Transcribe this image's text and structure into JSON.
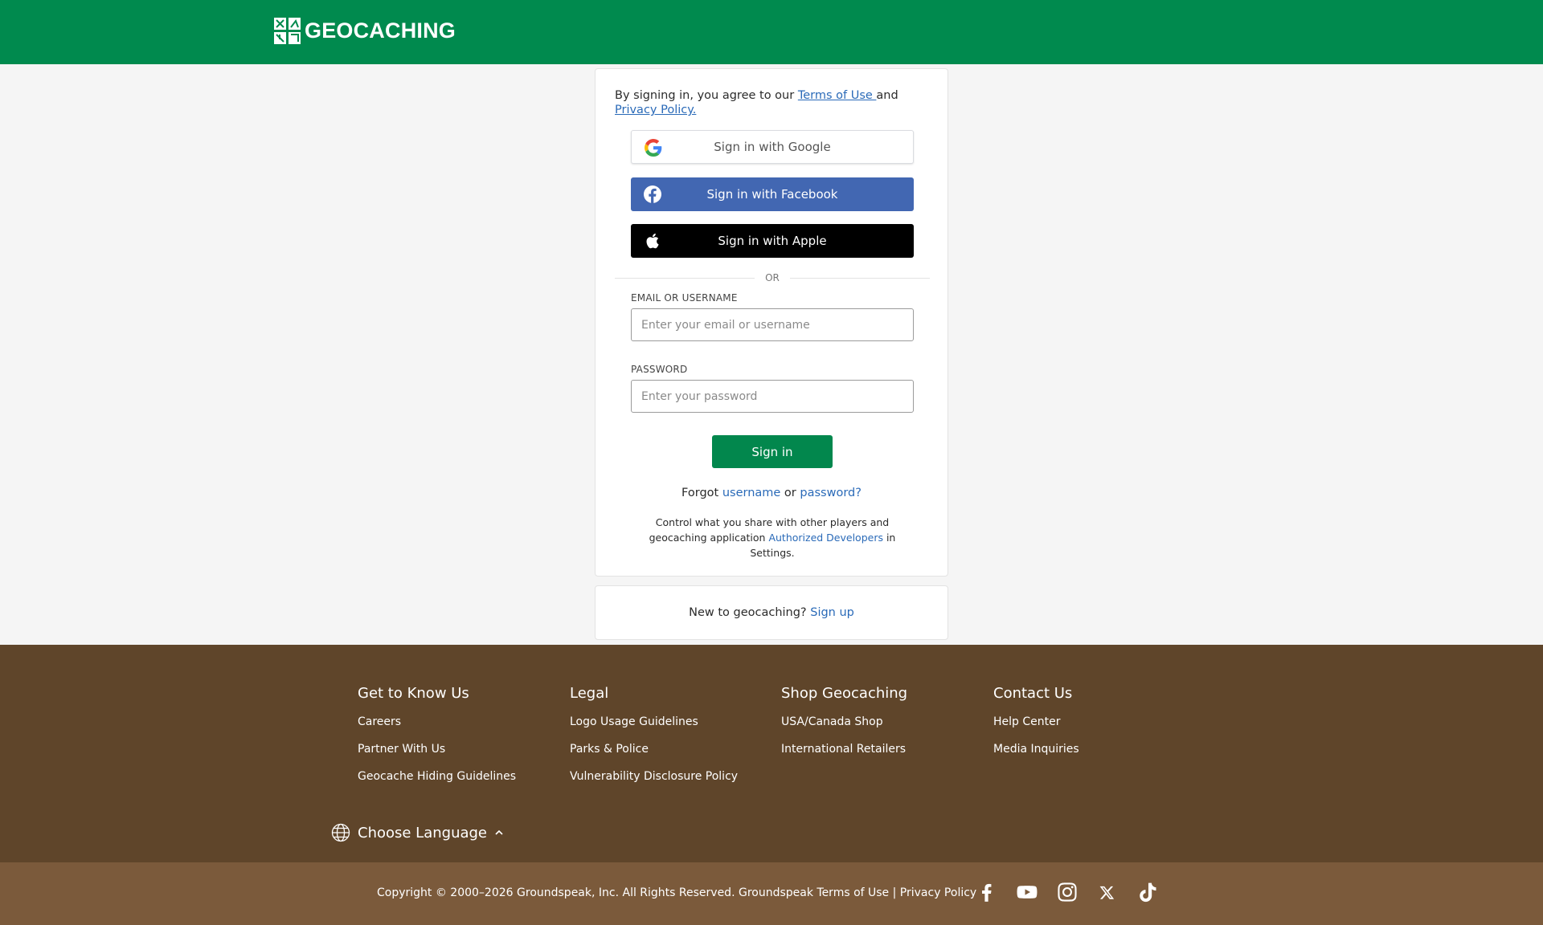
{
  "header": {
    "brand": "GEOCACHING"
  },
  "signin": {
    "agree_prefix": "By signing in, you agree to our ",
    "terms_link": "Terms of Use ",
    "agree_and": "and ",
    "privacy_link": "Privacy Policy.",
    "google_label": "Sign in with Google",
    "facebook_label": "Sign in with Facebook",
    "apple_label": "Sign in with Apple",
    "or": "OR",
    "email_label": "EMAIL OR USERNAME",
    "email_placeholder": "Enter your email or username",
    "password_label": "PASSWORD",
    "password_placeholder": "Enter your password",
    "submit": "Sign in",
    "forgot_prefix": "Forgot ",
    "forgot_username": "username",
    "forgot_or": " or ",
    "forgot_password": "password?",
    "control_prefix": "Control what you share with other players and geocaching application ",
    "control_link": "Authorized Developers",
    "control_suffix": " in Settings."
  },
  "signup": {
    "prompt": "New to geocaching? ",
    "link": "Sign up"
  },
  "footer": {
    "columns": [
      {
        "title": "Get to Know Us",
        "links": [
          "Careers",
          "Partner With Us",
          "Geocache Hiding Guidelines"
        ]
      },
      {
        "title": "Legal",
        "links": [
          "Logo Usage Guidelines",
          "Parks & Police",
          "Vulnerability Disclosure Policy"
        ]
      },
      {
        "title": "Shop Geocaching",
        "links": [
          "USA/Canada Shop",
          "International Retailers"
        ]
      },
      {
        "title": "Contact Us",
        "links": [
          "Help Center",
          "Media Inquiries"
        ]
      }
    ],
    "language": "Choose Language",
    "copyright": "Copyright © 2000–2026 Groundspeak, Inc. All Rights Reserved. ",
    "terms_link": "Groundspeak Terms of Use",
    "separator": " | ",
    "privacy_link": "Privacy Policy",
    "social_icons": [
      "facebook-icon",
      "youtube-icon",
      "instagram-icon",
      "x-icon",
      "tiktok-icon"
    ]
  },
  "colors": {
    "header_green": "#008a4e",
    "button_green": "#02874d",
    "facebook_blue": "#4267b2",
    "footer_brown": "#5f452a",
    "subfooter_brown": "#7b5a3b",
    "link_blue": "#2a6ab8"
  }
}
